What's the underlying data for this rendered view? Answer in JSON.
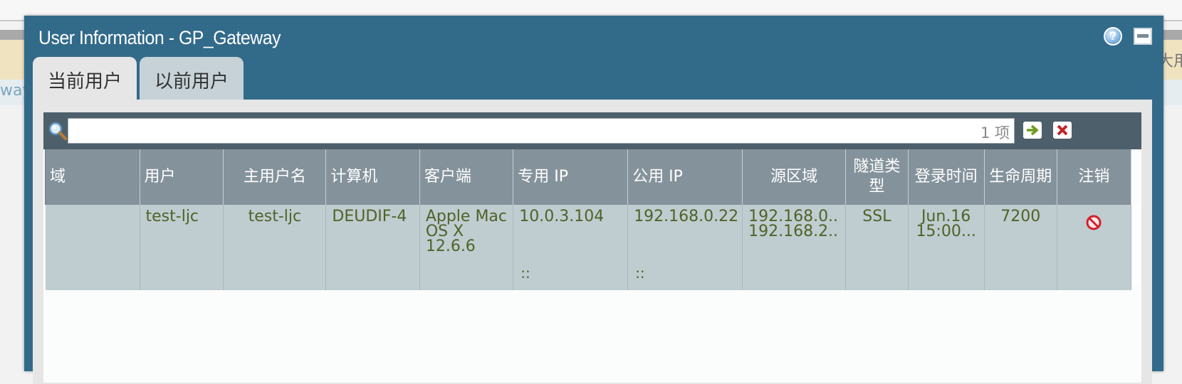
{
  "background": {
    "left_text": "way",
    "right_text": "大用"
  },
  "dialog": {
    "title": "User Information - GP_Gateway",
    "help_icon": "help-icon",
    "maximize_icon": "maximize-icon",
    "help_glyph": "?"
  },
  "tabs": [
    {
      "label": "当前用户",
      "active": true
    },
    {
      "label": "以前用户",
      "active": false
    }
  ],
  "search": {
    "icon": "search-icon",
    "count_text": "1 项",
    "go_icon": "arrow-right-icon",
    "clear_icon": "clear-filter-icon"
  },
  "table": {
    "columns": [
      "域",
      "用户",
      "主用户名",
      "计算机",
      "客户端",
      "专用 IP",
      "公用 IP",
      "源区域",
      "隧道类型",
      "登录时间",
      "生命周期",
      "注销"
    ],
    "rows": [
      {
        "domain": "",
        "user": "test-ljc",
        "primary_username": "test-ljc",
        "computer": "DEUDIF-4",
        "client": "Apple Mac OS X 12.6.6",
        "private_ip": "10.0.3.104",
        "private_ipv6": "::",
        "public_ip": "192.168.0.22",
        "public_ipv6": "::",
        "source_region_1": "192.168.0...",
        "source_region_2": "192.168.2...",
        "tunnel_type": "SSL",
        "login_time_1": "Jun.16",
        "login_time_2": "15:00...",
        "lifetime": "7200",
        "logout_icon": "logout-icon"
      }
    ]
  },
  "colors": {
    "dialog_bg": "#326a8a",
    "header_bg": "#84929b",
    "row_bg": "#bfccd0",
    "row_text": "#4f6326"
  }
}
